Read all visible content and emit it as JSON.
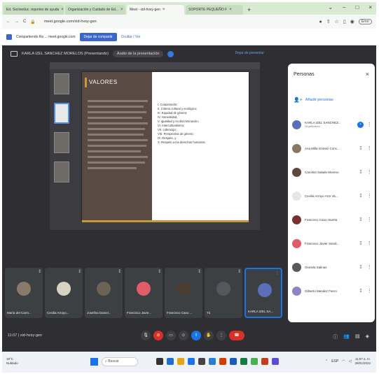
{
  "browser": {
    "tabs": [
      {
        "label": "Ed. Socioeduc. reportes de ayuda",
        "active": false
      },
      {
        "label": "Organización y Cuidado de Ed...",
        "active": false
      },
      {
        "label": "Meet - xid-hvxy-gen",
        "active": true
      },
      {
        "label": "SOPORTE PEQUEÑO F",
        "active": false
      }
    ],
    "new_tab": "+",
    "url": "meet.google.com/xid-hvxy-gen",
    "profile": "Error"
  },
  "infobar": {
    "message": "Compartiendo Re...: meet.google.com",
    "stop_button": "Dejar de compartir",
    "hide_link": "Ocultar / Ver"
  },
  "meet": {
    "presenter": "KARLA IZEL SANCHEZ MORELOS (Presentando)",
    "present_pill": "Audio de la presentación",
    "stop_presenting": "Dejar de presentar",
    "meeting_code": "11:07  |  xid-hvxy-gen"
  },
  "slide": {
    "title": "VALORES",
    "items": [
      "I. Cooperación;",
      "II. Criterio cultural y ecológico;",
      "III. Equidad de género;",
      "IV. Honestidad;",
      "V. Igualdad y no discriminación;",
      "VI. Interculturalismo;",
      "VII. Liderazgo;",
      "VIII. Perspectiva de género;",
      "IX. Respeto, y",
      "X. Respeto a los derechos humanos."
    ]
  },
  "people_panel": {
    "title": "Personas",
    "add_people": "Añadir personas",
    "participants": [
      {
        "name": "KARLA IZEL SANCHEZ...",
        "sub": "Organizador",
        "color": "#5b6fb8"
      },
      {
        "name": "Ana Milla Gómez Conc...",
        "sub": "",
        "color": "#8a7560"
      },
      {
        "name": "Carolina Salado Moreno",
        "sub": "",
        "color": "#5e4a3c"
      },
      {
        "name": "Cecilia Arroyo Arre Va...",
        "sub": "",
        "color": "#e6e6e6"
      },
      {
        "name": "Francisco Cano Huerta",
        "sub": "",
        "color": "#7a3030"
      },
      {
        "name": "Francisco Javier Sandi...",
        "sub": "",
        "color": "#e15b6b"
      },
      {
        "name": "Gloriela Salinas",
        "sub": "",
        "color": "#5a5a5a"
      },
      {
        "name": "Gilberto Mendez Fierro",
        "sub": "",
        "color": "#8e84c2"
      }
    ]
  },
  "tiles": [
    {
      "name": "María del Carm...",
      "color": "#8a7a6a"
    },
    {
      "name": "Cecilia Arroyo...",
      "color": "#d9d2c2"
    },
    {
      "name": "Josefina Daniel...",
      "color": "#6d6256"
    },
    {
      "name": "Francisco Javie...",
      "color": "#e15b6b"
    },
    {
      "name": "Francisco Cano ...",
      "color": "#4a3b33"
    },
    {
      "name": "Tú",
      "color": "#3c4043"
    },
    {
      "name": "KARLA IZEL SA...",
      "color": "#5b6fb8"
    }
  ],
  "taskbar": {
    "weather_temp": "19°C",
    "weather_desc": "Nublado",
    "search_placeholder": "Buscar",
    "time": "11:07 a. m.",
    "date": "28/01/2022",
    "lang": "ESP"
  }
}
